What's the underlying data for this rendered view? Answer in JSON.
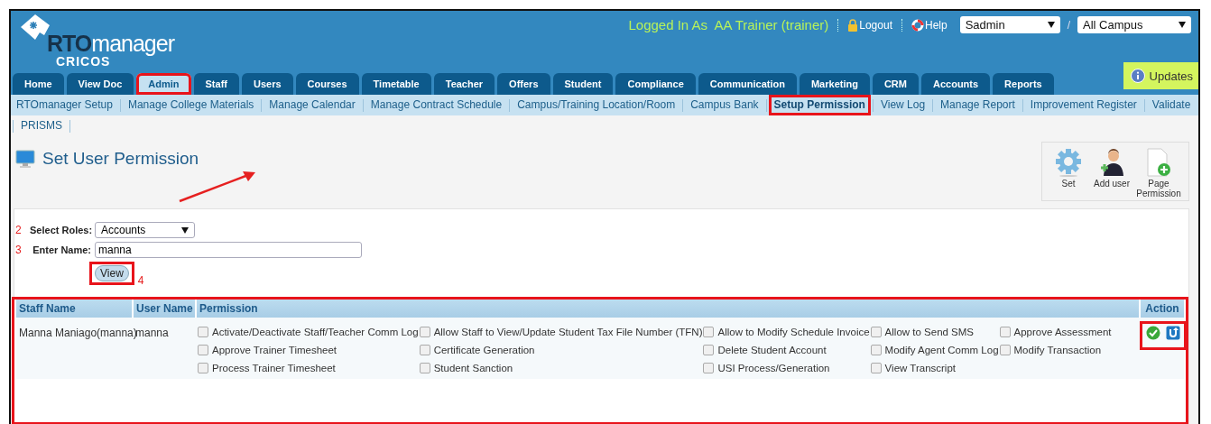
{
  "header": {
    "logo": {
      "brand_dark": "RTO",
      "brand_light": "manager",
      "sub": "CRICOS"
    },
    "logged_in": "Logged In As  AA Trainer (trainer)",
    "logout": "Logout",
    "help": "Help",
    "user_select": "Sadmin",
    "separator": "/",
    "campus_select": "All Campus",
    "updates": "Updates"
  },
  "tabs": [
    {
      "label": "Home",
      "selected": false,
      "highlighted": false
    },
    {
      "label": "View Doc",
      "selected": false,
      "highlighted": false
    },
    {
      "label": "Admin",
      "selected": true,
      "highlighted": true
    },
    {
      "label": "Staff",
      "selected": false,
      "highlighted": false
    },
    {
      "label": "Users",
      "selected": false,
      "highlighted": false
    },
    {
      "label": "Courses",
      "selected": false,
      "highlighted": false
    },
    {
      "label": "Timetable",
      "selected": false,
      "highlighted": false
    },
    {
      "label": "Teacher",
      "selected": false,
      "highlighted": false
    },
    {
      "label": "Offers",
      "selected": false,
      "highlighted": false
    },
    {
      "label": "Student",
      "selected": false,
      "highlighted": false
    },
    {
      "label": "Compliance",
      "selected": false,
      "highlighted": false
    },
    {
      "label": "Communication",
      "selected": false,
      "highlighted": false
    },
    {
      "label": "Marketing",
      "selected": false,
      "highlighted": false
    },
    {
      "label": "CRM",
      "selected": false,
      "highlighted": false
    },
    {
      "label": "Accounts",
      "selected": false,
      "highlighted": false
    },
    {
      "label": "Reports",
      "selected": false,
      "highlighted": false
    }
  ],
  "subnav": [
    {
      "label": "RTOmanager Setup",
      "selected": false,
      "highlighted": false
    },
    {
      "label": "Manage College Materials",
      "selected": false,
      "highlighted": false
    },
    {
      "label": "Manage Calendar",
      "selected": false,
      "highlighted": false
    },
    {
      "label": "Manage Contract Schedule",
      "selected": false,
      "highlighted": false
    },
    {
      "label": "Campus/Training Location/Room",
      "selected": false,
      "highlighted": false
    },
    {
      "label": "Campus Bank",
      "selected": false,
      "highlighted": false
    },
    {
      "label": "Setup Permission",
      "selected": true,
      "highlighted": true
    },
    {
      "label": "View Log",
      "selected": false,
      "highlighted": false
    },
    {
      "label": "Manage Report",
      "selected": false,
      "highlighted": false
    },
    {
      "label": "Improvement Register",
      "selected": false,
      "highlighted": false
    },
    {
      "label": "Validate",
      "selected": false,
      "highlighted": false
    },
    {
      "label": "PRISMS",
      "selected": false,
      "highlighted": false
    }
  ],
  "page_title": "Set User Permission",
  "toolbar": [
    {
      "kind": "gear",
      "label": "Set"
    },
    {
      "kind": "user",
      "label": "Add user"
    },
    {
      "kind": "page",
      "label": "Page Permission"
    }
  ],
  "form": {
    "roles_step": "2",
    "roles_label": "Select Roles:",
    "roles_value": "Accounts",
    "name_step": "3",
    "name_label": "Enter Name:",
    "name_value": "manna",
    "view_step": "4",
    "view_button": "View",
    "view_highlighted": true
  },
  "table": {
    "highlighted": true,
    "columns": [
      "Staff Name",
      "User Name",
      "Permission",
      "Action"
    ],
    "rows": [
      {
        "staff_name": "Manna Maniago(manna)",
        "user_name": "manna",
        "actions_highlighted": true,
        "permissions": [
          {
            "label": "Activate/Deactivate Staff/Teacher Comm Log",
            "checked": false
          },
          {
            "label": "Allow Staff to View/Update Student Tax File Number (TFN)",
            "checked": false
          },
          {
            "label": "Allow to Modify Schedule Invoice",
            "checked": false
          },
          {
            "label": "Allow to Send SMS",
            "checked": false
          },
          {
            "label": "Approve Assessment",
            "checked": false
          },
          {
            "label": "Approve Trainer Timesheet",
            "checked": false
          },
          {
            "label": "Certificate Generation",
            "checked": false
          },
          {
            "label": "Delete Student Account",
            "checked": false
          },
          {
            "label": "Modify Agent Comm Log",
            "checked": false
          },
          {
            "label": "Modify Transaction",
            "checked": false
          },
          {
            "label": "Process Trainer Timesheet",
            "checked": false
          },
          {
            "label": "Student Sanction",
            "checked": false
          },
          {
            "label": "USI Process/Generation",
            "checked": false
          },
          {
            "label": "View Transcript",
            "checked": false
          }
        ]
      }
    ]
  }
}
